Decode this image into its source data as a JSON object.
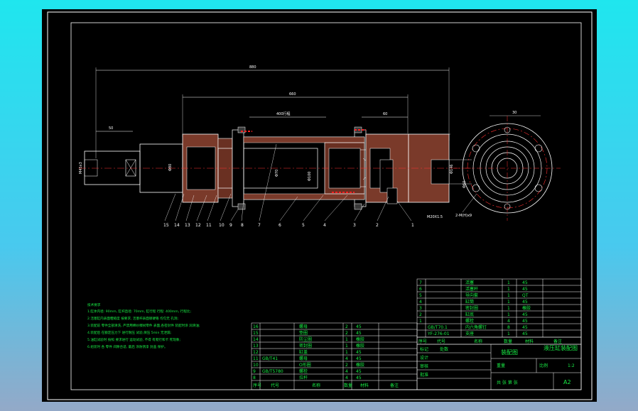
{
  "dimensions": {
    "overall_length": "880",
    "cylinder_length": "660",
    "rod_end_length": "50",
    "port_offset": "60",
    "stroke": "400行程",
    "side_width": "30",
    "rod_thread": "M45x3",
    "dia_a": "Φ80",
    "dia_b": "Φ70",
    "dia_c": "Φ100",
    "dia_d": "Φ146",
    "dia_e": "Φ60",
    "port_thread": "M20X1.5",
    "mount_holes": "2-M(H)x9",
    "side_note": "45"
  },
  "balloons": [
    "15",
    "14",
    "13",
    "12",
    "11",
    "10",
    "9",
    "8",
    "7",
    "6",
    "5",
    "4",
    "3",
    "2",
    "1"
  ],
  "tech_notes": {
    "title": "技术要求",
    "lines": [
      "1.缸体内径: 90mm, 缸杆直径: 70mm, 缸行程 行程: 400mm, 行程比;",
      "2.活塞缸内表面粗糙度 按要求, 活塞杆表面镀硬铬 均匀无 孔洞;",
      "3.装配前 零件全部清洗, 严禁用棉纱擦拭零件 表面,各密封件 装配时涂 润滑油;",
      "4.装配后 在额定压力下 进行耐压 试验,保压 5min 无泄漏;",
      "5.油缸试验时 按照 要求进行 运动试验, 不得 有爬行和卡 死现象;",
      "6.组装时 各 零件 间隙合适, 最后 涂防锈漆 封盖 保护。"
    ]
  },
  "top_parts": [
    {
      "no": "7",
      "code": "",
      "name": "活塞",
      "qty": "1",
      "mat": "45"
    },
    {
      "no": "6",
      "code": "",
      "name": "活塞杆",
      "qty": "1",
      "mat": "45"
    },
    {
      "no": "5",
      "code": "",
      "name": "导向套",
      "qty": "1",
      "mat": "QT"
    },
    {
      "no": "4",
      "code": "",
      "name": "缸筒",
      "qty": "1",
      "mat": "45"
    },
    {
      "no": "3",
      "code": "",
      "name": "密封圈",
      "qty": "1",
      "mat": "橡胶"
    },
    {
      "no": "2",
      "code": "",
      "name": "缸底",
      "qty": "1",
      "mat": "45"
    },
    {
      "no": "1",
      "code": "",
      "name": "螺栓",
      "qty": "4",
      "mat": "45"
    },
    {
      "no": "",
      "code": "GB/T70.1",
      "name": "内六角螺钉",
      "qty": "8",
      "mat": "45"
    },
    {
      "no": "",
      "code": "YF-276-01",
      "name": "支座",
      "qty": "1",
      "mat": "45"
    }
  ],
  "top_header": {
    "no": "序号",
    "code": "代号",
    "name": "名称",
    "qty": "数量",
    "mat": "材料",
    "remark": "备注"
  },
  "bottom_parts": [
    {
      "no": "16",
      "code": "",
      "name": "螺母",
      "qty": "2",
      "mat": "45"
    },
    {
      "no": "15",
      "code": "",
      "name": "垫圈",
      "qty": "2",
      "mat": "45"
    },
    {
      "no": "14",
      "code": "",
      "name": "防尘圈",
      "qty": "1",
      "mat": "橡胶"
    },
    {
      "no": "13",
      "code": "",
      "name": "密封圈",
      "qty": "1",
      "mat": "橡胶"
    },
    {
      "no": "12",
      "code": "",
      "name": "缸盖",
      "qty": "1",
      "mat": "45"
    },
    {
      "no": "11",
      "code": "GB/T41",
      "name": "螺母",
      "qty": "4",
      "mat": "45"
    },
    {
      "no": "10",
      "code": "",
      "name": "O形圈",
      "qty": "2",
      "mat": "橡胶"
    },
    {
      "no": "9",
      "code": "GB/T5780",
      "name": "螺栓",
      "qty": "4",
      "mat": "45"
    },
    {
      "no": "8",
      "code": "",
      "name": "拉杆",
      "qty": "4",
      "mat": "45"
    }
  ],
  "bottom_header": {
    "no": "序号",
    "code": "代号",
    "name": "名称",
    "qty": "数量",
    "mat": "材料",
    "remark": "备注"
  },
  "title_block": {
    "title": "液压缸装配图",
    "unit": "装配图",
    "scale": "1:2",
    "sheet_size": "A2",
    "designer": "设计",
    "checker": "审核",
    "approver": "批准",
    "marks": "标记",
    "qty_label": "处数",
    "weight": "重量",
    "ratio_label": "比例",
    "sheet_label": "共 张 第 张"
  }
}
